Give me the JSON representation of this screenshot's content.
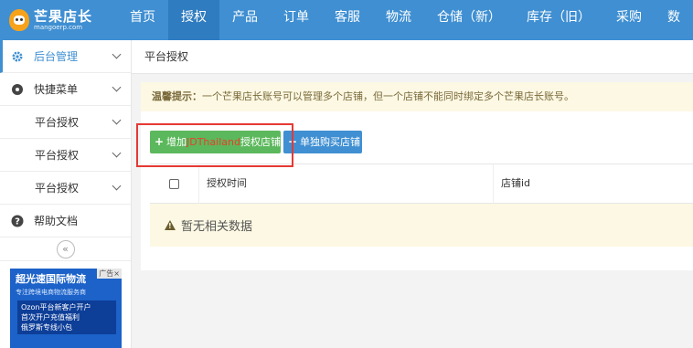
{
  "header": {
    "logo_title": "芒果店长",
    "logo_sub": "mangoerp.com",
    "nav": [
      {
        "label": "首页"
      },
      {
        "label": "授权",
        "active": true
      },
      {
        "label": "产品"
      },
      {
        "label": "订单"
      },
      {
        "label": "客服"
      },
      {
        "label": "物流"
      },
      {
        "label": "仓储（新）"
      },
      {
        "label": "库存（旧）"
      },
      {
        "label": "采购"
      },
      {
        "label": "数"
      }
    ]
  },
  "sidebar": {
    "items": [
      {
        "label": "后台管理",
        "icon": "gear-icon"
      },
      {
        "label": "快捷菜单",
        "icon": "disc-icon"
      },
      {
        "label": "平台授权"
      },
      {
        "label": "平台授权"
      },
      {
        "label": "平台授权"
      },
      {
        "label": "帮助文档",
        "icon": "help-icon"
      }
    ],
    "collapse_label": "«",
    "ad": {
      "close": "广告×",
      "headline": "超光速国际物流",
      "tagline": "专注跨境电商物流服务商",
      "lines": [
        "Ozon平台新客户开户",
        "首次开户充值福利",
        "俄罗斯专线小包"
      ]
    }
  },
  "main": {
    "breadcrumb": "平台授权",
    "tip_label": "温馨提示：",
    "tip_text": "一个芒果店长账号可以管理多个店铺，但一个店铺不能同时绑定多个芒果店长账号。",
    "add_button": {
      "prefix": "增加",
      "highlight": "JDThailand",
      "suffix": "授权店铺"
    },
    "buy_button": "单独购买店铺",
    "table": {
      "columns": [
        "授权时间",
        "店铺id"
      ],
      "empty_text": "暂无相关数据"
    }
  },
  "colors": {
    "primary": "#3f8fd2",
    "success": "#5cb85c",
    "highlight_border": "#e53935",
    "tip_bg": "#fcf8e3"
  }
}
